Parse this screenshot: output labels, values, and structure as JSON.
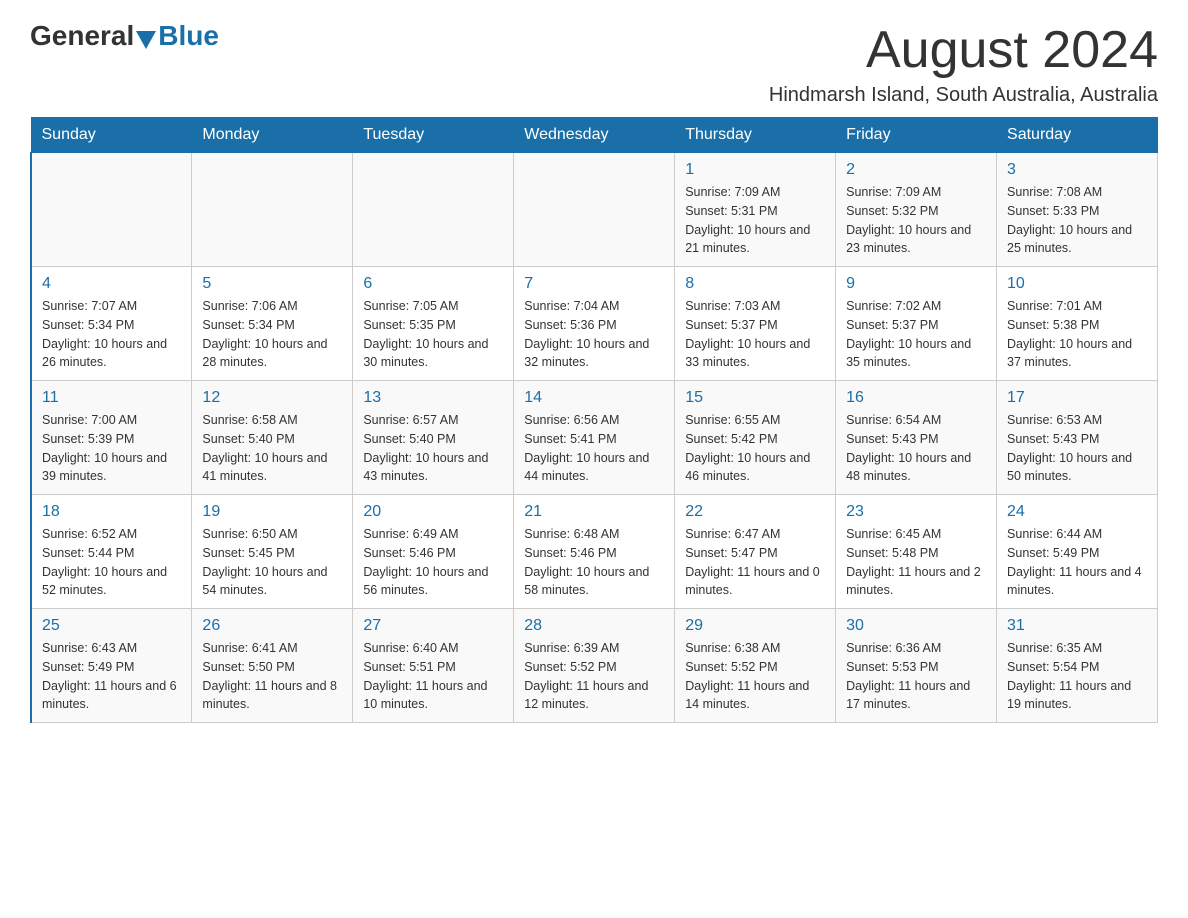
{
  "header": {
    "logo_general": "General",
    "logo_blue": "Blue",
    "month_title": "August 2024",
    "location": "Hindmarsh Island, South Australia, Australia"
  },
  "days_of_week": [
    "Sunday",
    "Monday",
    "Tuesday",
    "Wednesday",
    "Thursday",
    "Friday",
    "Saturday"
  ],
  "weeks": [
    {
      "days": [
        {
          "number": "",
          "info": ""
        },
        {
          "number": "",
          "info": ""
        },
        {
          "number": "",
          "info": ""
        },
        {
          "number": "",
          "info": ""
        },
        {
          "number": "1",
          "info": "Sunrise: 7:09 AM\nSunset: 5:31 PM\nDaylight: 10 hours and 21 minutes."
        },
        {
          "number": "2",
          "info": "Sunrise: 7:09 AM\nSunset: 5:32 PM\nDaylight: 10 hours and 23 minutes."
        },
        {
          "number": "3",
          "info": "Sunrise: 7:08 AM\nSunset: 5:33 PM\nDaylight: 10 hours and 25 minutes."
        }
      ]
    },
    {
      "days": [
        {
          "number": "4",
          "info": "Sunrise: 7:07 AM\nSunset: 5:34 PM\nDaylight: 10 hours and 26 minutes."
        },
        {
          "number": "5",
          "info": "Sunrise: 7:06 AM\nSunset: 5:34 PM\nDaylight: 10 hours and 28 minutes."
        },
        {
          "number": "6",
          "info": "Sunrise: 7:05 AM\nSunset: 5:35 PM\nDaylight: 10 hours and 30 minutes."
        },
        {
          "number": "7",
          "info": "Sunrise: 7:04 AM\nSunset: 5:36 PM\nDaylight: 10 hours and 32 minutes."
        },
        {
          "number": "8",
          "info": "Sunrise: 7:03 AM\nSunset: 5:37 PM\nDaylight: 10 hours and 33 minutes."
        },
        {
          "number": "9",
          "info": "Sunrise: 7:02 AM\nSunset: 5:37 PM\nDaylight: 10 hours and 35 minutes."
        },
        {
          "number": "10",
          "info": "Sunrise: 7:01 AM\nSunset: 5:38 PM\nDaylight: 10 hours and 37 minutes."
        }
      ]
    },
    {
      "days": [
        {
          "number": "11",
          "info": "Sunrise: 7:00 AM\nSunset: 5:39 PM\nDaylight: 10 hours and 39 minutes."
        },
        {
          "number": "12",
          "info": "Sunrise: 6:58 AM\nSunset: 5:40 PM\nDaylight: 10 hours and 41 minutes."
        },
        {
          "number": "13",
          "info": "Sunrise: 6:57 AM\nSunset: 5:40 PM\nDaylight: 10 hours and 43 minutes."
        },
        {
          "number": "14",
          "info": "Sunrise: 6:56 AM\nSunset: 5:41 PM\nDaylight: 10 hours and 44 minutes."
        },
        {
          "number": "15",
          "info": "Sunrise: 6:55 AM\nSunset: 5:42 PM\nDaylight: 10 hours and 46 minutes."
        },
        {
          "number": "16",
          "info": "Sunrise: 6:54 AM\nSunset: 5:43 PM\nDaylight: 10 hours and 48 minutes."
        },
        {
          "number": "17",
          "info": "Sunrise: 6:53 AM\nSunset: 5:43 PM\nDaylight: 10 hours and 50 minutes."
        }
      ]
    },
    {
      "days": [
        {
          "number": "18",
          "info": "Sunrise: 6:52 AM\nSunset: 5:44 PM\nDaylight: 10 hours and 52 minutes."
        },
        {
          "number": "19",
          "info": "Sunrise: 6:50 AM\nSunset: 5:45 PM\nDaylight: 10 hours and 54 minutes."
        },
        {
          "number": "20",
          "info": "Sunrise: 6:49 AM\nSunset: 5:46 PM\nDaylight: 10 hours and 56 minutes."
        },
        {
          "number": "21",
          "info": "Sunrise: 6:48 AM\nSunset: 5:46 PM\nDaylight: 10 hours and 58 minutes."
        },
        {
          "number": "22",
          "info": "Sunrise: 6:47 AM\nSunset: 5:47 PM\nDaylight: 11 hours and 0 minutes."
        },
        {
          "number": "23",
          "info": "Sunrise: 6:45 AM\nSunset: 5:48 PM\nDaylight: 11 hours and 2 minutes."
        },
        {
          "number": "24",
          "info": "Sunrise: 6:44 AM\nSunset: 5:49 PM\nDaylight: 11 hours and 4 minutes."
        }
      ]
    },
    {
      "days": [
        {
          "number": "25",
          "info": "Sunrise: 6:43 AM\nSunset: 5:49 PM\nDaylight: 11 hours and 6 minutes."
        },
        {
          "number": "26",
          "info": "Sunrise: 6:41 AM\nSunset: 5:50 PM\nDaylight: 11 hours and 8 minutes."
        },
        {
          "number": "27",
          "info": "Sunrise: 6:40 AM\nSunset: 5:51 PM\nDaylight: 11 hours and 10 minutes."
        },
        {
          "number": "28",
          "info": "Sunrise: 6:39 AM\nSunset: 5:52 PM\nDaylight: 11 hours and 12 minutes."
        },
        {
          "number": "29",
          "info": "Sunrise: 6:38 AM\nSunset: 5:52 PM\nDaylight: 11 hours and 14 minutes."
        },
        {
          "number": "30",
          "info": "Sunrise: 6:36 AM\nSunset: 5:53 PM\nDaylight: 11 hours and 17 minutes."
        },
        {
          "number": "31",
          "info": "Sunrise: 6:35 AM\nSunset: 5:54 PM\nDaylight: 11 hours and 19 minutes."
        }
      ]
    }
  ]
}
